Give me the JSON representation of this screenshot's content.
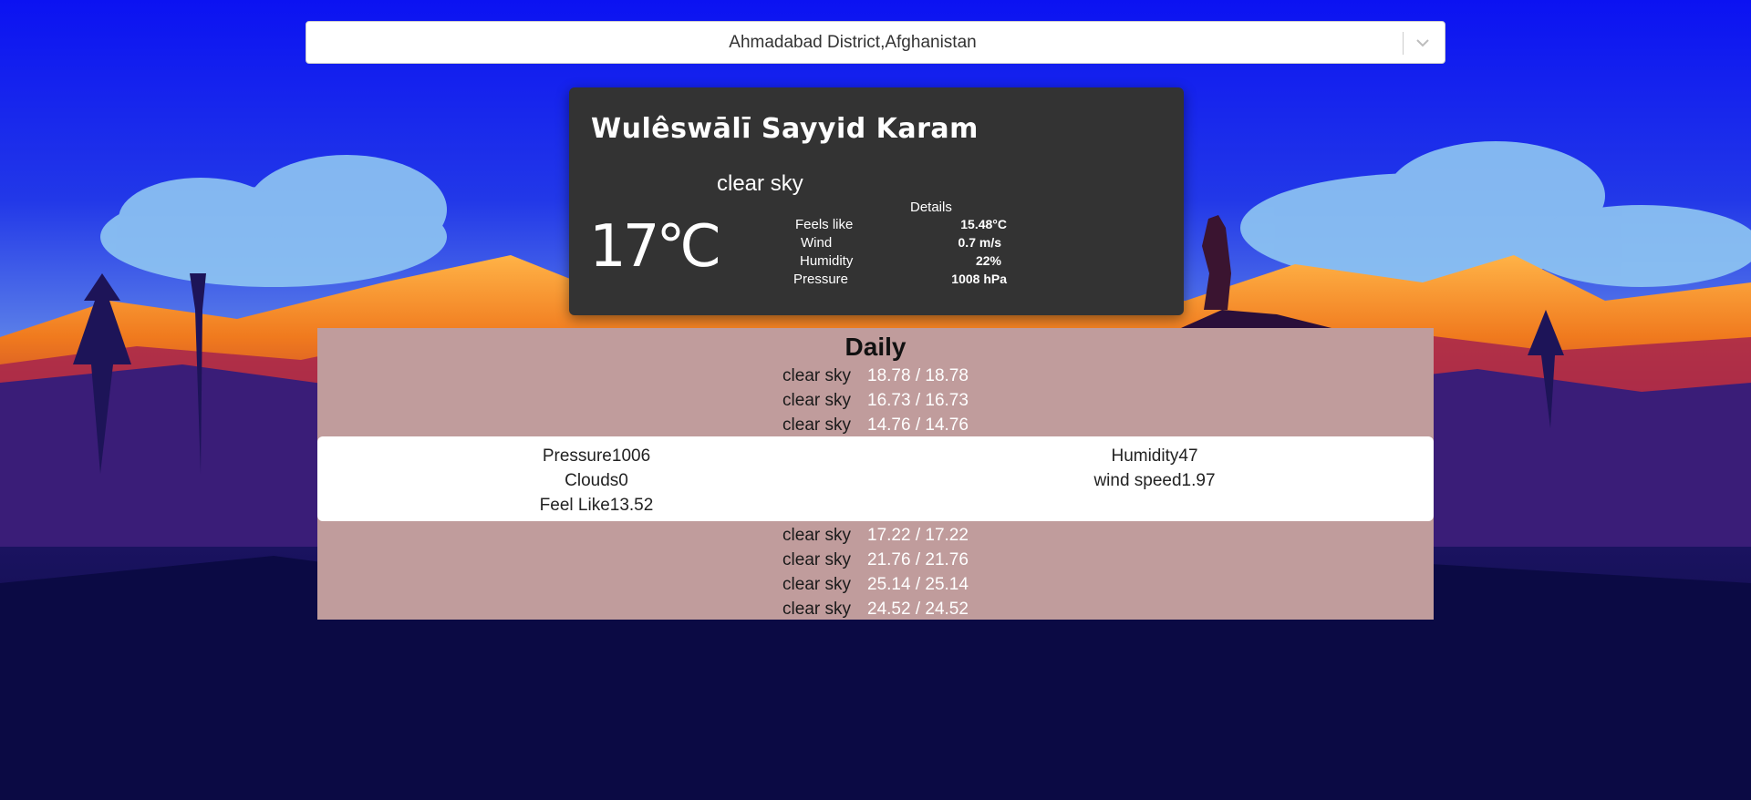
{
  "search": {
    "selected": "Ahmadabad District,Afghanistan",
    "dropdown_icon": "chevron-down-icon"
  },
  "current": {
    "city": "Wulêswālī Sayyid Karam",
    "description": "clear sky",
    "temperature": "17℃",
    "details_title": "Details",
    "details": [
      {
        "label": "Feels like",
        "value": "15.48°C"
      },
      {
        "label": "Wind",
        "value": "0.7 m/s"
      },
      {
        "label": "Humidity",
        "value": "22%"
      },
      {
        "label": "Pressure",
        "value": "1008 hPa"
      }
    ]
  },
  "daily": {
    "title": "Daily",
    "items": [
      {
        "desc": "clear sky",
        "temp": "18.78 / 18.78"
      },
      {
        "desc": "clear sky",
        "temp": "16.73 / 16.73"
      },
      {
        "desc": "clear sky",
        "temp": "14.76 / 14.76"
      },
      {
        "desc": "clear sky",
        "temp": "17.22 / 17.22"
      },
      {
        "desc": "clear sky",
        "temp": "21.76 / 21.76"
      },
      {
        "desc": "clear sky",
        "temp": "25.14 / 25.14"
      },
      {
        "desc": "clear sky",
        "temp": "24.52 / 24.52"
      }
    ],
    "expanded": {
      "pressure": "Pressure1006",
      "clouds": "Clouds0",
      "feels_like": "Feel Like13.52",
      "humidity": "Humidity47",
      "wind_speed": "wind speed1.97"
    }
  },
  "colors": {
    "card_bg": "#333333",
    "daily_bg": "#c09c9c",
    "sky_top": "#0a1cf0"
  }
}
